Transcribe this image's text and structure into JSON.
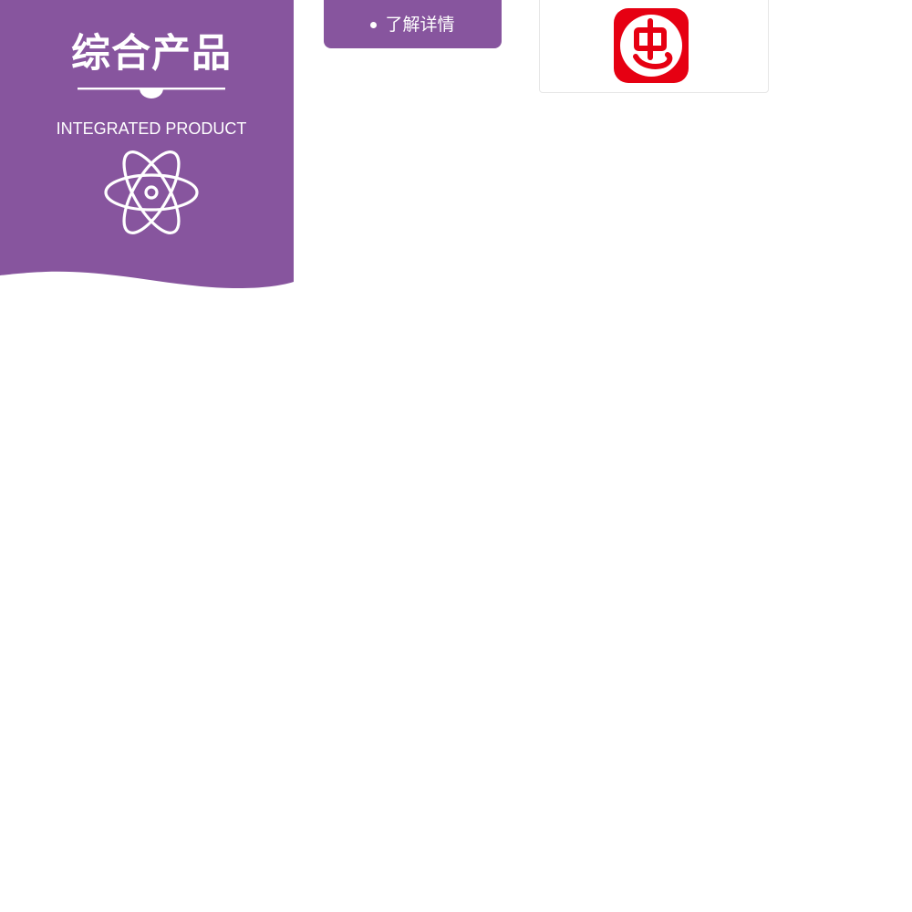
{
  "category": {
    "title": "综合产品",
    "subtitle": "INTEGRATED PRODUCT",
    "icon": "atom-icon",
    "color": "#87559e"
  },
  "details_button": {
    "label": "了解详情",
    "color": "#87559e"
  },
  "app_card": {
    "logo_icon": "red-app-logo-icon",
    "logo_color": "#e60012"
  }
}
